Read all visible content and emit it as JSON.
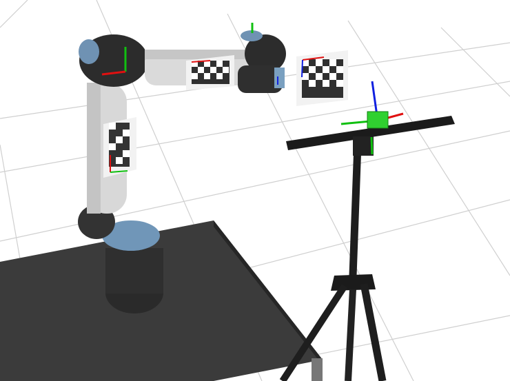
{
  "scene": {
    "background_color": "#ffffff",
    "grid_color": "#cfcfcf",
    "table_color": "#3a3a3a",
    "robot_link_color": "#d9d9d9",
    "robot_joint_color": "#2c2c2c",
    "robot_cap_color": "#6f92b3",
    "tripod_color": "#1f1f1f",
    "axis_colors": {
      "x": "#e01010",
      "y": "#10c010",
      "z": "#1020e0"
    },
    "marker_box_color": "#30d030",
    "icons": [
      "robot-arm",
      "calibration-board",
      "tripod",
      "camera-mount",
      "coordinate-frame"
    ]
  }
}
